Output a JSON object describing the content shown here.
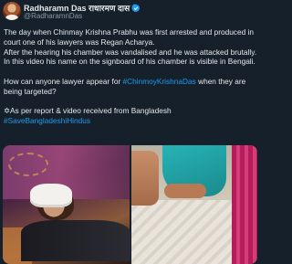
{
  "author": {
    "display_name": "Radharamn Das राधारमण दास",
    "handle": "@RadharamnDas",
    "verified_color": "#1d9bf0"
  },
  "tweet": {
    "line1": "The day when Chinmay Krishna Prabhu was first arrested and produced in court one of his lawyers was Regan Acharya.",
    "line2": "After the hearing his chamber was vandalised and he was attacked brutally. In this video his name on the signboard of his chamber is visible in Bengali.",
    "line3_before": "How can anyone lawyer appear for ",
    "line3_hashtag": "#ChinmoyKrishnaDas",
    "line3_after": " when they are being targeted?",
    "line4": "✡As per report & video received from Bangladesh",
    "line5_hashtag": "#SaveBangladeshiHindus"
  },
  "media": {
    "count": 2,
    "icons": [
      "injured-man-photo",
      "bed-photo"
    ]
  }
}
